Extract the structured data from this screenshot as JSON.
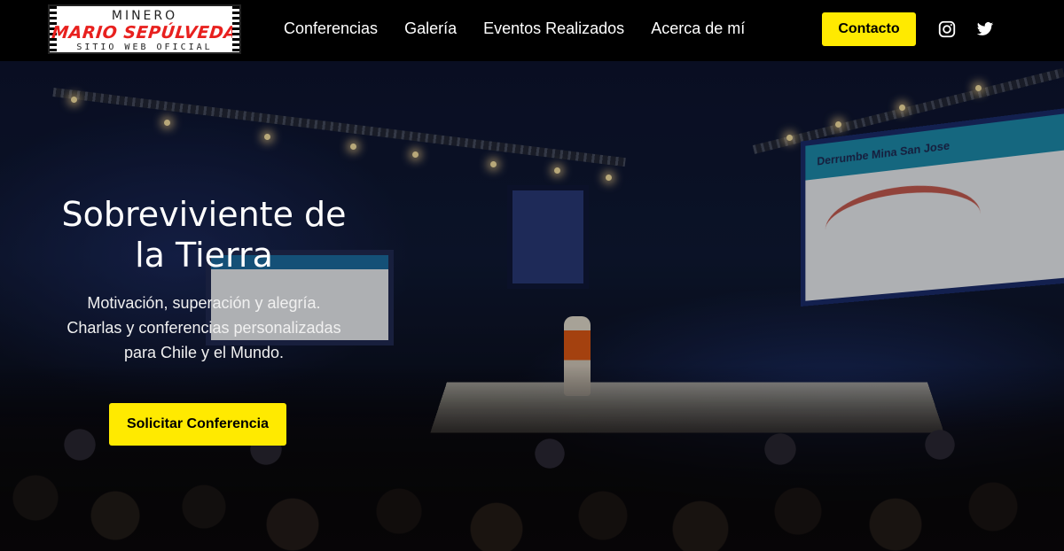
{
  "logo": {
    "top": "MINERO",
    "name": "MARIO SEPÚLVEDA",
    "sub": "SITIO WEB OFICIAL"
  },
  "nav": {
    "items": [
      {
        "label": "Conferencias"
      },
      {
        "label": "Galería"
      },
      {
        "label": "Eventos Realizados"
      },
      {
        "label": "Acerca de mí"
      }
    ],
    "contact_label": "Contacto",
    "social": [
      {
        "icon": "instagram-icon"
      },
      {
        "icon": "twitter-icon"
      }
    ]
  },
  "hero": {
    "title_line1": "Sobreviviente de",
    "title_line2": "la Tierra",
    "lines": [
      "Motivación, superación y alegría.",
      "Charlas y conferencias personalizadas",
      "para Chile y el Mundo."
    ],
    "cta_label": "Solicitar Conferencia",
    "screen_title": "Derrumbe Mina San Jose"
  },
  "colors": {
    "accent": "#ffea00",
    "navbar": "#000000",
    "logo_red": "#e8201e"
  }
}
